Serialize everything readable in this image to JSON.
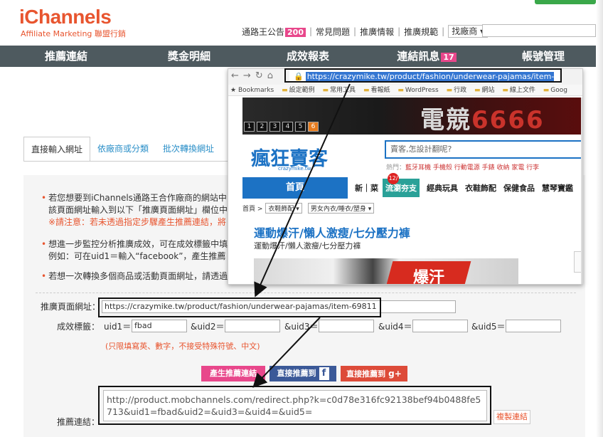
{
  "header": {
    "logo": "iChannels",
    "logo_sub": "Affiliate Marketing 聯盟行銷",
    "links": [
      {
        "label": "通路王公告",
        "badge": "200"
      },
      {
        "label": "常見問題"
      },
      {
        "label": "推廣情報"
      },
      {
        "label": "推廣規範"
      }
    ],
    "merchant_select": "找廠商",
    "search_value": ""
  },
  "nav": {
    "items": [
      {
        "label": "推薦連結"
      },
      {
        "label": "獎金明細"
      },
      {
        "label": "成效報表"
      },
      {
        "label": "連結訊息",
        "badge": "17"
      },
      {
        "label": "帳號管理"
      }
    ]
  },
  "tabs": [
    {
      "label": "直接輸入網址",
      "active": true
    },
    {
      "label": "依廠商或分類"
    },
    {
      "label": "批次轉換網址"
    }
  ],
  "instructions": {
    "b1_line1": "若您想要到iChannels通路王合作廠商的網站中",
    "b1_line2": "該頁面網址輸入到以下「推廣頁面網址」欄位中",
    "b1_warn": "※請注意：若未透過指定步驟產生推薦連結，將",
    "b2_line1": "想進一步監控分析推廣成效，可在成效標籤中填",
    "b2_line2": "例如：可在uid1＝輸入“facebook”，產生推薦",
    "b3_line1": "若想一次轉換多個商品或活動頁面網址，請透過"
  },
  "form": {
    "page_url_label": "推廣頁面網址：",
    "page_url_value": "https://crazymike.tw/product/fashion/underwear-pajamas/item-69811",
    "tags_label": "成效標籤：",
    "uid1_label": "uid1＝",
    "uid1_value": "fbad",
    "uid2_label": "&uid2＝",
    "uid3_label": "&uid3＝",
    "uid4_label": "&uid4＝",
    "uid5_label": "&uid5＝",
    "hint": "(只限填寫英、數字，不接受特殊符號、中文)",
    "generate_button": "產生推薦連結",
    "fb_button": "直接推薦到",
    "gplus_button": "直接推薦到",
    "result_label": "推薦連結：",
    "result_value": "http://product.mobchannels.com/redirect.php?k=c0d78e316fc92138bef94b0488fe5713&uid1=fbad&uid2=&uid3=&uid4=&uid5=",
    "copy_button": "複製連結"
  },
  "browser": {
    "url": "https://crazymike.tw/product/fashion/underwear-pajamas/item-69811",
    "bookmarks": [
      "Bookmarks",
      "設定範例",
      "常用工具",
      "看報紙",
      "WordPress",
      "行政",
      "網站",
      "線上文件",
      "Goog"
    ],
    "banner_title": "電競",
    "banner_num": "6666",
    "banner_pages": [
      "1",
      "2",
      "3",
      "4",
      "5",
      "6"
    ],
    "site_logo": "瘋狂賣客",
    "site_logo_sub": "crazymike.tw",
    "search_placeholder": "賣客,怎設計翻呢?",
    "hot_label": "熱門：",
    "hot_items": "藍牙耳機  手機殼  行動電源  手錶  收納  家電  行李",
    "site_nav": {
      "home": "首頁",
      "new": "新｜菜",
      "new_badge": "12/",
      "green": "流瀏夯支",
      "items": [
        "經典玩具",
        "衣鞋飾配",
        "保健食品",
        "慧琴寶鑑"
      ]
    },
    "breadcrumb": {
      "home": "首頁 >",
      "cat1": "衣鞋飾配",
      "cat2": "男女內衣/睡衣/塑身"
    },
    "product_title": "運動爆汗/懶人激瘦/七分壓力褲",
    "product_sub": "運動爆汗/懶人激瘦/七分壓力褲",
    "burst_text": "爆汗"
  }
}
